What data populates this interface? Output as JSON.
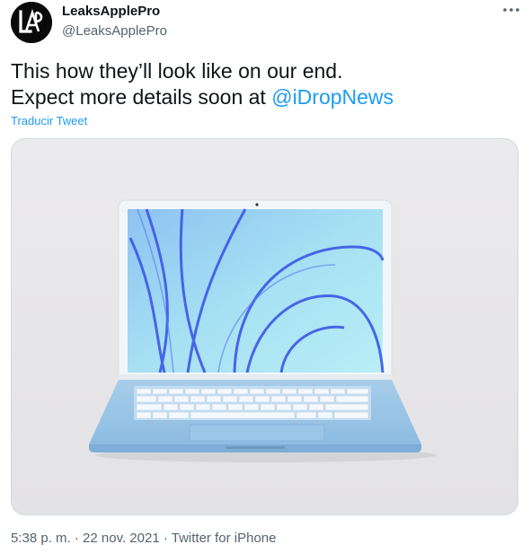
{
  "author": {
    "display_name": "LeaksApplePro",
    "handle": "@LeaksApplePro",
    "avatar_icon": "lap-logo-icon",
    "avatar_text": "LAP"
  },
  "menu": {
    "icon": "more-horizontal-icon"
  },
  "tweet": {
    "line1": "This how they’ll look like on our end.",
    "line2_prefix": "Expect more details soon at ",
    "mention": "@iDropNews",
    "translate_label": "Traducir Tweet"
  },
  "media": {
    "description_icon": "macbook-image",
    "colors": {
      "laptop_body": "#9ec8e8",
      "screen_wallpaper": "#7fb6f0",
      "bezel": "#f4f7f9"
    }
  },
  "meta": {
    "time": "5:38 p. m.",
    "separator": " · ",
    "date": "22 nov. 2021",
    "source": "Twitter for iPhone"
  },
  "colors": {
    "link": "#1d9bf0",
    "secondary_text": "#536471",
    "primary_text": "#0f1419"
  }
}
